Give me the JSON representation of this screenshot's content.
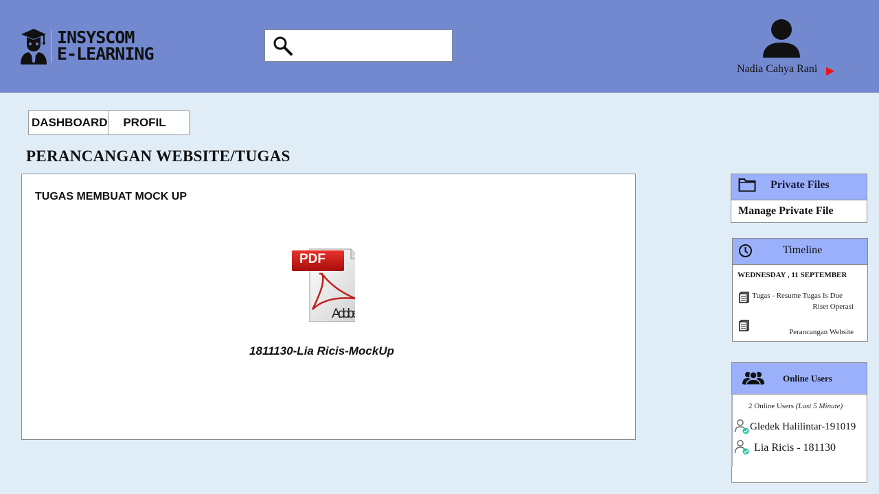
{
  "header": {
    "logo": {
      "line1": "INSYSCOM",
      "line2": "E-LEARNING",
      "icon": "graduate-icon"
    },
    "search": {
      "placeholder": "",
      "value": "",
      "icon": "search-icon"
    },
    "user": {
      "name": "Nadia Cahya Rani",
      "avatar_icon": "user-silhouette-icon",
      "menu_icon": "triangle-right-icon",
      "menu_color": "#ee1111"
    }
  },
  "nav": {
    "tabs": [
      {
        "label": "DASHBOARD"
      },
      {
        "label": "PROFIL"
      }
    ]
  },
  "page": {
    "title": "PERANCANGAN WEBSITE/TUGAS"
  },
  "content": {
    "task_title": "TUGAS MEMBUAT MOCK UP",
    "file": {
      "icon": "pdf-file-icon",
      "badge": "PDF",
      "brand": "Adobe",
      "name": "1811130-Lia Ricis-MockUp"
    }
  },
  "sidebar": {
    "private_files": {
      "title": "Private Files",
      "icon": "folder-icon",
      "action": "Manage Private File"
    },
    "timeline": {
      "title": "Timeline",
      "icon": "clock-icon",
      "date": "WEDNESDAY , 11 SEPTEMBER",
      "events": [
        {
          "icon": "document-icon",
          "line1": "Tugas  - Resume Tugas Is Due",
          "line2": "Riset Operasi"
        },
        {
          "icon": "document-icon",
          "line1": "Perancangan Website"
        }
      ]
    },
    "online_users": {
      "title": "Online Users",
      "icon": "users-group-icon",
      "count_text": "2 Online Users",
      "count_note": "(Last 5 Minute)",
      "users": [
        {
          "name": "Gledek Halilintar-191019",
          "icon": "online-user-icon"
        },
        {
          "name": "Lia Ricis - 181130",
          "icon": "online-user-icon"
        }
      ]
    }
  },
  "colors": {
    "header_bg": "#7289d0",
    "page_bg": "#e1edf6",
    "panel_head_bg": "#9ab0fb",
    "online_check": "#22c3a3"
  }
}
